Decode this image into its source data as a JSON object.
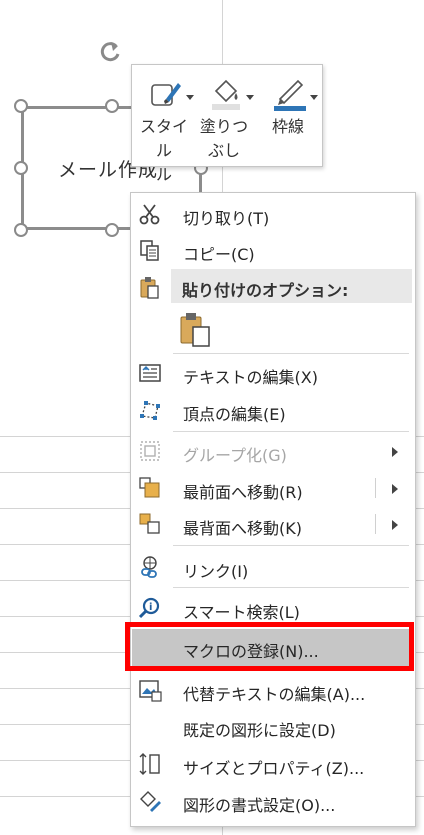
{
  "shape": {
    "text": "メール作成"
  },
  "mini_toolbar": {
    "buttons": [
      {
        "label_line1": "スタイル",
        "label_line2": "ル"
      },
      {
        "label_line1": "塗りつ",
        "label_line2": "ぶし"
      },
      {
        "label_line1": "枠線",
        "label_line2": ""
      }
    ]
  },
  "context_menu": {
    "items": [
      {
        "label": "切り取り(T)",
        "icon": "scissors-icon"
      },
      {
        "label": "コピー(C)",
        "icon": "copy-icon"
      },
      {
        "label": "貼り付けのオプション:",
        "icon": "clipboard-icon"
      },
      {
        "label": "テキストの編集(X)",
        "icon": "edit-text-icon"
      },
      {
        "label": "頂点の編集(E)",
        "icon": "edit-points-icon"
      },
      {
        "label": "グループ化(G)",
        "icon": "group-icon",
        "disabled": true
      },
      {
        "label": "最前面へ移動(R)",
        "icon": "bring-to-front-icon"
      },
      {
        "label": "最背面へ移動(K)",
        "icon": "send-to-back-icon"
      },
      {
        "label": "リンク(I)",
        "icon": "link-icon"
      },
      {
        "label": "スマート検索(L)",
        "icon": "smart-lookup-icon"
      },
      {
        "label": "マクロの登録(N)...",
        "icon": ""
      },
      {
        "label": "代替テキストの編集(A)...",
        "icon": "alt-text-icon"
      },
      {
        "label": "既定の図形に設定(D)",
        "icon": ""
      },
      {
        "label": "サイズとプロパティ(Z)...",
        "icon": "size-properties-icon"
      },
      {
        "label": "図形の書式設定(O)...",
        "icon": "format-shape-icon"
      }
    ]
  },
  "colors": {
    "highlight": "#ff0000",
    "accent_blue": "#2e75b6",
    "hover_gray": "#c6c6c6"
  }
}
